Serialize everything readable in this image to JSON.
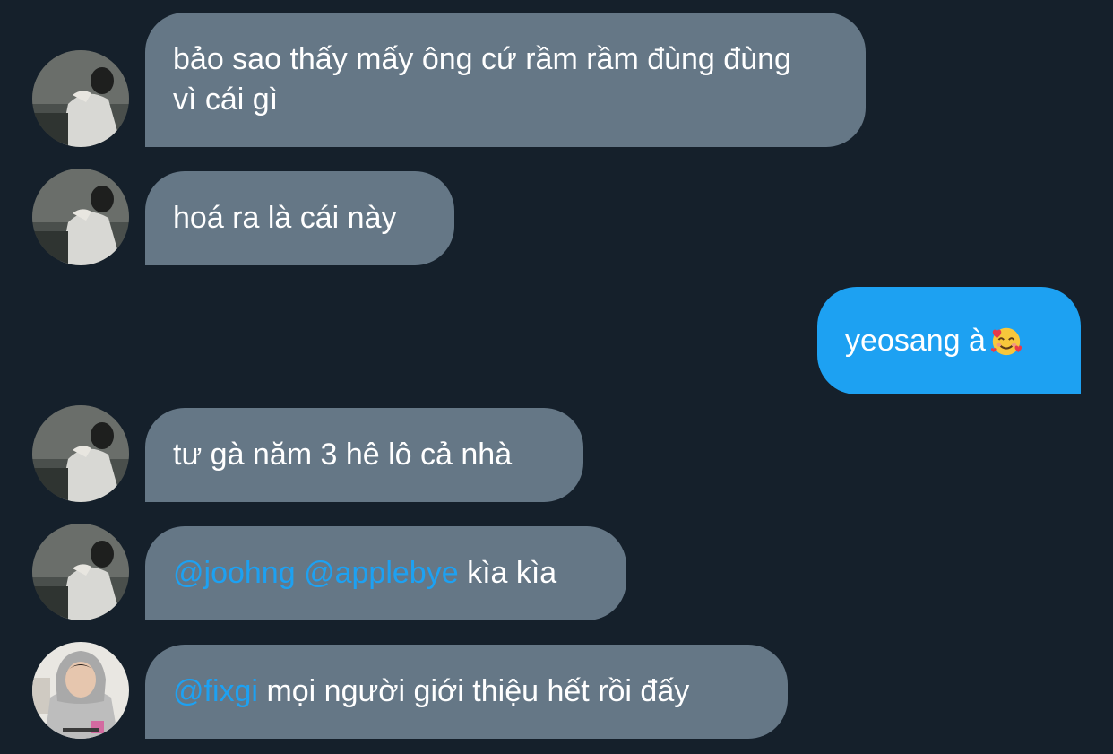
{
  "conversation": {
    "messages": [
      {
        "direction": "incoming",
        "sender": "user-a",
        "text": "bảo sao thấy mấy ông cứ rầm rầm đùng đùng vì cái gì"
      },
      {
        "direction": "incoming",
        "sender": "user-a",
        "text": "hoá ra là cái này"
      },
      {
        "direction": "outgoing",
        "text": "yeosang à",
        "emoji": "smiling-face-with-hearts"
      },
      {
        "direction": "incoming",
        "sender": "user-a",
        "text": "tư gà năm 3 hê lô cả nhà"
      },
      {
        "direction": "incoming",
        "sender": "user-a",
        "mentions": [
          "@joohng",
          "@applebye"
        ],
        "text": "kìa kìa"
      },
      {
        "direction": "incoming",
        "sender": "user-b",
        "mentions": [
          "@fixgi"
        ],
        "text": "mọi người giới thiệu hết rồi đấy"
      }
    ]
  },
  "colors": {
    "background": "#15202b",
    "incoming_bubble": "#657786",
    "outgoing_bubble": "#1da1f2",
    "mention": "#1da1f2",
    "text": "#ffffff"
  }
}
